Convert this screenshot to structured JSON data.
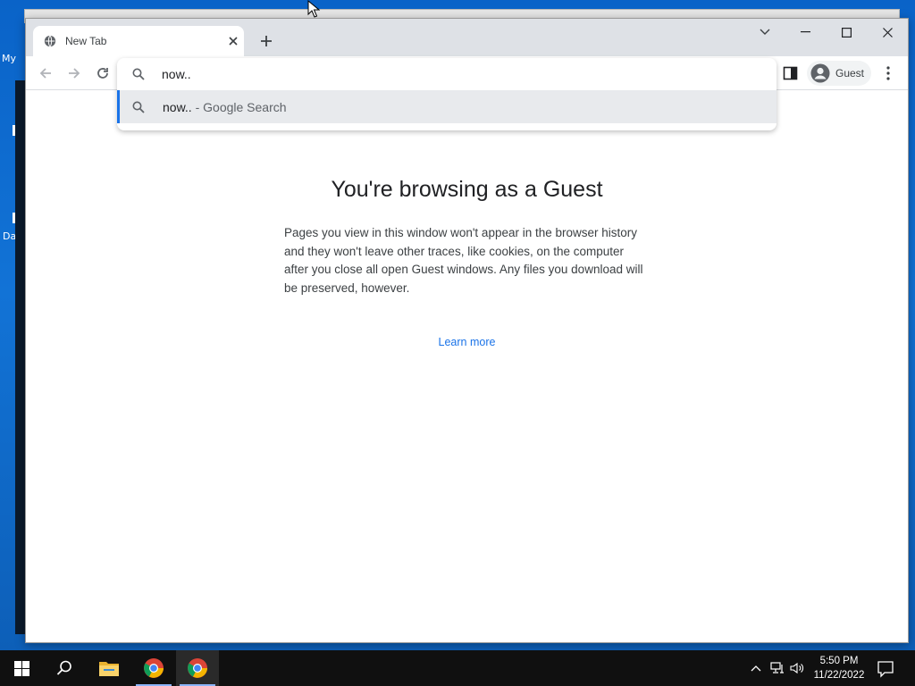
{
  "desktop": {
    "icon_labels": [
      "My",
      "Da"
    ]
  },
  "browser": {
    "tab": {
      "title": "New Tab",
      "favicon": "globe-icon",
      "close_icon": "close-icon"
    },
    "new_tab_icon": "plus-icon",
    "window_controls": [
      "tab-search-icon",
      "minimize-icon",
      "maximize-icon",
      "close-icon"
    ],
    "toolbar": {
      "back_icon": "arrow-left-icon",
      "forward_icon": "arrow-right-icon",
      "reload_icon": "reload-icon",
      "side_panel_icon": "side-panel-icon",
      "profile_label": "Guest",
      "menu_icon": "kebab-menu-icon"
    },
    "omnibox": {
      "value": "now..",
      "suggestion_query": "now..",
      "suggestion_suffix": " - Google Search",
      "accent": "#1a73e8"
    }
  },
  "page": {
    "title": "You're browsing as a Guest",
    "body": "Pages you view in this window won't appear in the browser history and they won't leave other traces, like cookies, on the computer after you close all open Guest windows. Any files you download will be preserved, however.",
    "learn_more": "Learn more"
  },
  "taskbar": {
    "items": [
      "windows-start-icon",
      "search-icon",
      "file-explorer-icon",
      "chrome-icon",
      "chrome-icon"
    ],
    "tray": [
      "chevron-up-icon",
      "network-icon",
      "volume-icon"
    ],
    "time": "5:50 PM",
    "date": "11/22/2022",
    "notification_icon": "notification-icon"
  }
}
